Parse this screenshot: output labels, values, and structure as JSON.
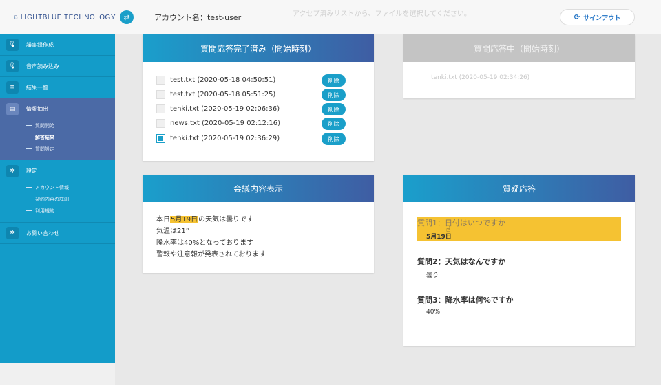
{
  "header": {
    "logo_text": "LIGHTBLUE TECHNOLOGY",
    "account_label": "アカウント名：test-user",
    "overlay_message": "アクセプ済みリストから、ファイルを選択してください。",
    "signout_label": "サインアウト"
  },
  "sidebar": {
    "items": [
      {
        "label": "議事録作成",
        "icon": "mic-icon"
      },
      {
        "label": "音声読み込み",
        "icon": "mic-icon"
      },
      {
        "label": "結果一覧",
        "icon": "database-icon"
      },
      {
        "label": "情報抽出",
        "icon": "document-icon"
      }
    ],
    "info_sub": [
      "質問開始",
      "解答結果",
      "質問設定"
    ],
    "settings_label": "設定",
    "settings_sub": [
      "アカウント情報",
      "契約内容の詳細",
      "利用規約"
    ],
    "contact_label": "お問い合わせ"
  },
  "completed_card": {
    "title": "質問応答完了済み（開始時刻）",
    "delete_label": "削除",
    "files": [
      {
        "name": "test.txt (2020-05-18 04:50:51)",
        "checked": false
      },
      {
        "name": "test.txt (2020-05-18 05:51:25)",
        "checked": false
      },
      {
        "name": "tenki.txt (2020-05-19 02:06:36)",
        "checked": false
      },
      {
        "name": "news.txt (2020-05-19 02:12:16)",
        "checked": false
      },
      {
        "name": "tenki.txt (2020-05-19 02:36:29)",
        "checked": true
      }
    ]
  },
  "inprogress_card": {
    "title": "質問応答中（開始時刻）",
    "item": "tenki.txt (2020-05-19 02:34:26)"
  },
  "meeting_card": {
    "title": "会議内容表示",
    "line1_pre": "本日",
    "line1_hl": "5月19日",
    "line1_post": "の天気は曇りです",
    "line2": "気温は21°",
    "line3": "降水率は40%となっております",
    "line4": "警報や注意報が発表されております"
  },
  "qa_card": {
    "title": "質疑応答",
    "items": [
      {
        "q": "質問1：日付はいつですか",
        "a": "5月19日"
      },
      {
        "q": "質問2：天気はなんですか",
        "a": "曇り"
      },
      {
        "q": "質問3：降水率は何%ですか",
        "a": "40%"
      }
    ]
  },
  "colors": {
    "accent": "#1a9fc9",
    "sidebar": "#139cc9",
    "sidebar_active": "#4b6aa6",
    "highlight": "#f5c232"
  }
}
